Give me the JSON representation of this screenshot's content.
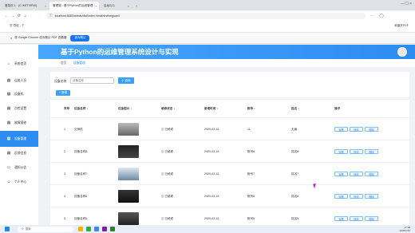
{
  "browser": {
    "tabs": [
      {
        "label": "登录页 1 · (C:\\KETVIEW)"
      },
      {
        "label": "管理端 - 基于Python的运维管理..."
      },
      {
        "label": "后台2(1)"
      }
    ],
    "url": "localhost:8080/admin/dist/index.html#/shebeiguanli",
    "bookmark": "导航 - 个",
    "right_action": "收藏夹PDF",
    "infobar_text": "将 Google Chrome 设为默认 PDF 查看器",
    "infobar_button": "设为默认"
  },
  "sidebar": {
    "items": [
      {
        "label": "系统首页",
        "icon": "home-icon"
      },
      {
        "label": "运维人员",
        "icon": "grid-icon"
      },
      {
        "label": "设备机",
        "icon": "grid-icon"
      },
      {
        "label": "点检设置",
        "icon": "grid-icon"
      },
      {
        "label": "故障报修",
        "icon": "grid-icon"
      },
      {
        "label": "设备管理",
        "icon": "grid-icon"
      },
      {
        "label": "反馈信息",
        "icon": "grid-icon"
      },
      {
        "label": "通知公告",
        "icon": "monitor-icon"
      },
      {
        "label": "个人中心",
        "icon": "user-icon"
      }
    ],
    "active_index": 5
  },
  "header": {
    "title": "基于Python的运维管理系统设计与实现"
  },
  "breadcrumb": {
    "home": "首页",
    "current": "设备管理"
  },
  "search": {
    "label": "设备名称",
    "placeholder": "设备名称",
    "button": "查询",
    "add_button": "+ 新增"
  },
  "table": {
    "columns": [
      "序号",
      "设备名称 ↕",
      "设备图片 ↕",
      "维修状态 ↕",
      "新增时间 ↕",
      "账号 ↕",
      "姓名 ↕",
      "操作"
    ],
    "rows": [
      {
        "index": "1",
        "name": "交换机",
        "status": "已维修",
        "time": "2020-03-15",
        "account": "11",
        "person": "无痕"
      },
      {
        "index": "2",
        "name": "设备名称8",
        "status": "已维修",
        "time": "2020-03-15",
        "account": "账号8",
        "person": "姓名8"
      },
      {
        "index": "3",
        "name": "设备名称7",
        "status": "已维修",
        "time": "2020-03-15",
        "account": "账号7",
        "person": "姓名7"
      },
      {
        "index": "4",
        "name": "设备名称6",
        "status": "已维修",
        "time": "2020-03-15",
        "account": "账号6",
        "person": "姓名6"
      },
      {
        "index": "5",
        "name": "设备名称5",
        "status": "已维修",
        "time": "2020-03-15",
        "account": "账号5",
        "person": "姓名5"
      }
    ],
    "actions": [
      "查看",
      "修改",
      "删除"
    ]
  },
  "taskbar": {
    "search_placeholder": "搜索",
    "time": "17:48",
    "date": "2025/1/10"
  },
  "colors": {
    "accent": "#2d8cf0",
    "header_start": "#47a6ff",
    "header_end": "#2d8cf0"
  }
}
